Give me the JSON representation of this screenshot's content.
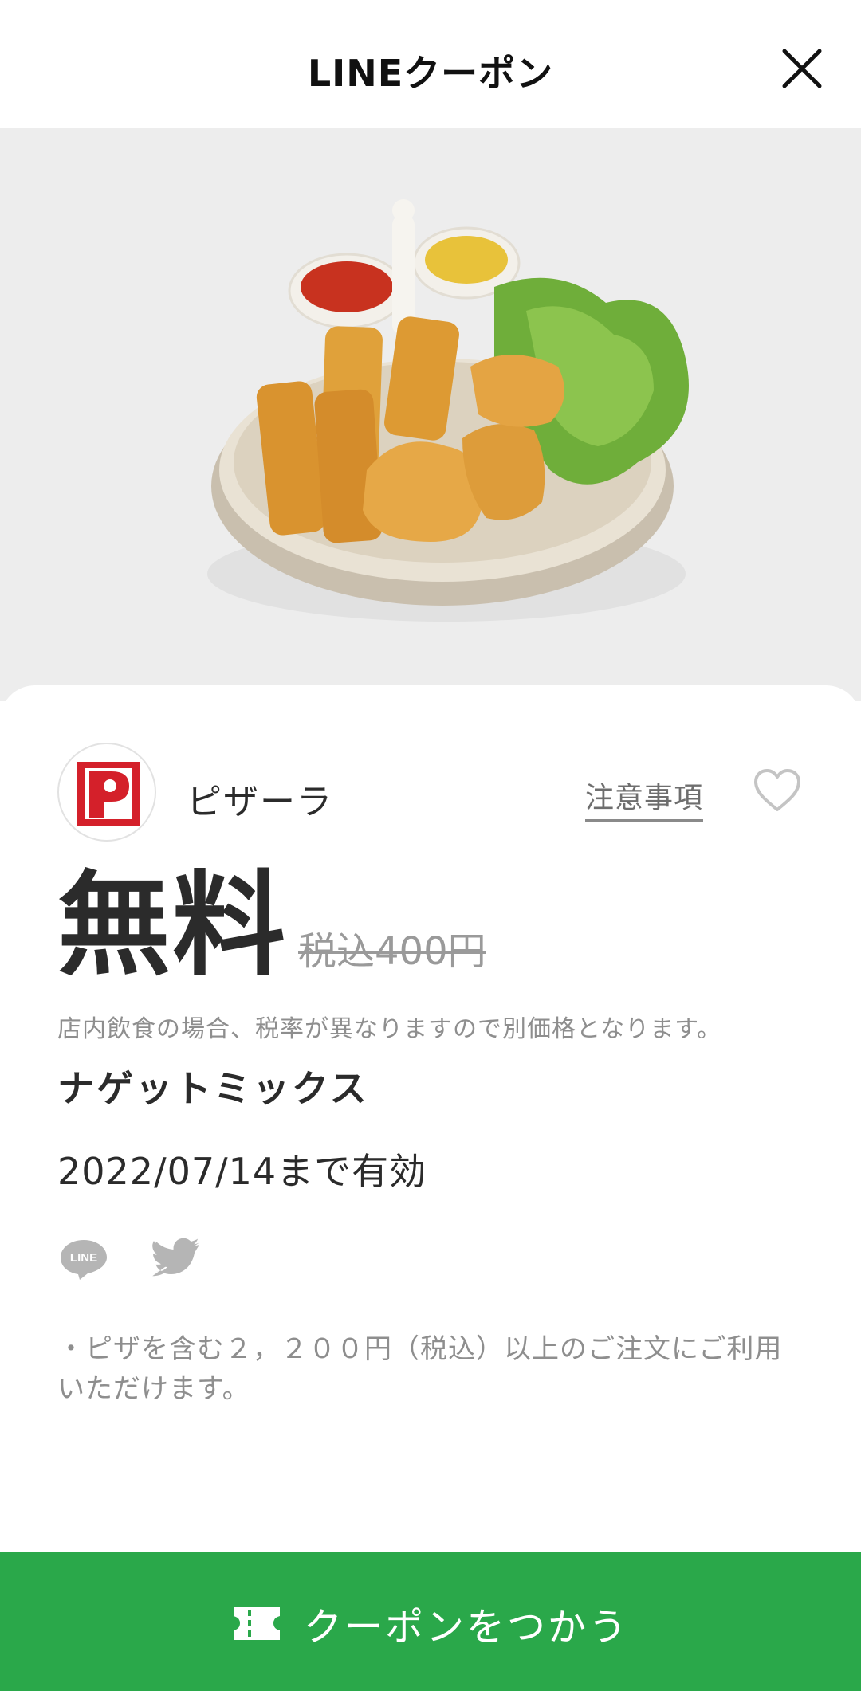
{
  "header": {
    "title": "LINEクーポン"
  },
  "coupon": {
    "brand": "ピザーラ",
    "notice_link": "注意事項",
    "price": "無料",
    "original_price": "税込400円",
    "tax_note": "店内飲食の場合、税率が異なりますので別価格となります。",
    "item_name": "ナゲットミックス",
    "validity": "2022/07/14まで有効",
    "share_line_label": "LINE",
    "terms": "・ピザを含む２，２００円（税込）以上のご注文にご利用いただけます。"
  },
  "action": {
    "use_label": "クーポンをつかう"
  },
  "colors": {
    "accent": "#2aa84a",
    "brand_red": "#d4202a"
  },
  "icons": [
    "close-icon",
    "heart-icon",
    "line-icon",
    "twitter-icon",
    "ticket-icon"
  ]
}
